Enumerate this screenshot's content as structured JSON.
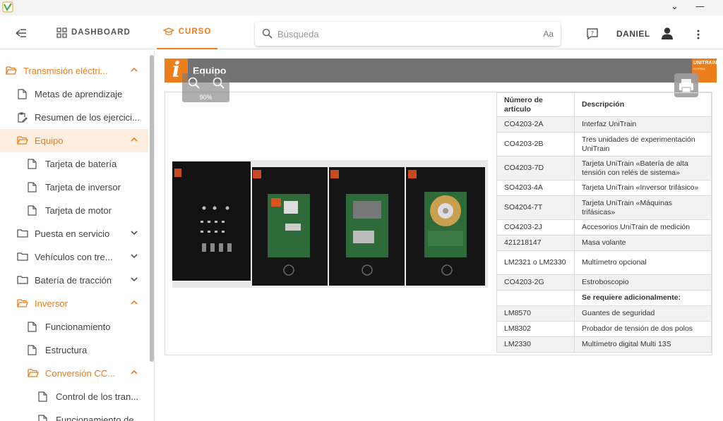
{
  "window": {
    "minimize": "⌄",
    "maximize": "—"
  },
  "header": {
    "dashboard_label": "DASHBOARD",
    "curso_label": "CURSO",
    "search_placeholder": "Búsqueda",
    "case_toggle": "Aa",
    "user_name": "DANIEL"
  },
  "sidebar": {
    "items": [
      {
        "label": "Transmisión eléctri...",
        "icon": "folder-open-icon",
        "chevron": "up"
      },
      {
        "label": "Metas de aprendizaje",
        "icon": "document-icon"
      },
      {
        "label": "Resumen de los ejercici...",
        "icon": "clipboard-edit-icon"
      },
      {
        "label": "Equipo",
        "icon": "folder-open-icon",
        "chevron": "up"
      },
      {
        "label": "Tarjeta de batería",
        "icon": "document-icon"
      },
      {
        "label": "Tarjeta de inversor",
        "icon": "document-icon"
      },
      {
        "label": "Tarjeta de motor",
        "icon": "document-icon"
      },
      {
        "label": "Puesta en servicio",
        "icon": "folder-icon",
        "chevron": "down"
      },
      {
        "label": "Vehículos con tre...",
        "icon": "folder-icon",
        "chevron": "down"
      },
      {
        "label": "Batería de tracción",
        "icon": "folder-icon",
        "chevron": "down"
      },
      {
        "label": "Inversor",
        "icon": "folder-open-icon",
        "chevron": "up"
      },
      {
        "label": "Funcionamiento",
        "icon": "document-icon"
      },
      {
        "label": "Estructura",
        "icon": "document-icon"
      },
      {
        "label": "Conversión CC...",
        "icon": "folder-open-icon",
        "chevron": "up"
      },
      {
        "label": "Control de los tran...",
        "icon": "document-icon"
      },
      {
        "label": "Funcionamiento de",
        "icon": "document-icon"
      }
    ]
  },
  "page": {
    "title": "Equipo",
    "info_glyph": "i",
    "brand_logo": "UNITRAIN",
    "zoom_level": "90%"
  },
  "table": {
    "headers": [
      "Número de artículo",
      "Descripción"
    ],
    "rows": [
      [
        "CO4203-2A",
        "Interfaz UniTrain"
      ],
      [
        "CO4203-2B",
        "Tres unidades de experimentación UniTrain"
      ],
      [
        "CO4203-7D",
        "Tarjeta UniTrain «Batería de alta tensión con relés de sistema»"
      ],
      [
        "SO4203-4A",
        "Tarjeta UniTrain «Inversor trifásico»"
      ],
      [
        "SO4204-7T",
        "Tarjeta UniTrain «Máquinas trifásicas»"
      ],
      [
        "CO4203-2J",
        "Accesorios UniTrain de medición"
      ],
      [
        "421218147",
        "Masa volante"
      ],
      [
        "LM2321 o LM2330",
        "Multímetro opcional"
      ],
      [
        "CO4203-2G",
        "Estroboscopio"
      ],
      [
        "",
        "Se requiere adicionalmente:"
      ],
      [
        "LM8570",
        "Guantes de seguridad"
      ],
      [
        "LM8302",
        "Probador de tensión de dos polos"
      ],
      [
        "LM2330",
        "Multímetro digital Multi 13S"
      ]
    ]
  },
  "colors": {
    "accent": "#ee7d1c",
    "banner": "#737373",
    "active_bg": "#fdeee0"
  }
}
